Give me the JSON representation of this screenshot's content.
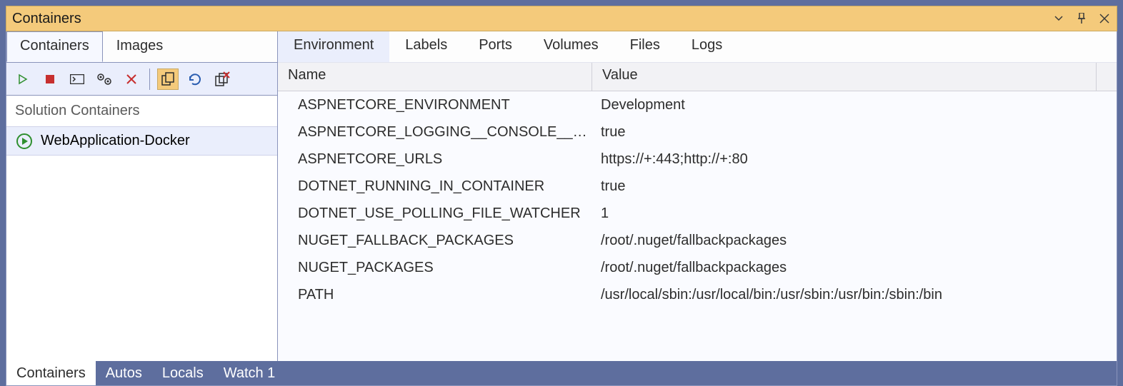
{
  "title": "Containers",
  "sidebar": {
    "tabs": [
      {
        "label": "Containers",
        "active": true
      },
      {
        "label": "Images",
        "active": false
      }
    ],
    "toolbar_icons": [
      "play",
      "stop",
      "terminal",
      "settings-gear",
      "delete",
      "copy",
      "refresh",
      "remove-copy"
    ],
    "section_label": "Solution Containers",
    "items": [
      {
        "icon": "running-icon",
        "label": "WebApplication-Docker"
      }
    ]
  },
  "right": {
    "tabs": [
      {
        "label": "Environment",
        "active": true
      },
      {
        "label": "Labels",
        "active": false
      },
      {
        "label": "Ports",
        "active": false
      },
      {
        "label": "Volumes",
        "active": false
      },
      {
        "label": "Files",
        "active": false
      },
      {
        "label": "Logs",
        "active": false
      }
    ],
    "columns": {
      "name": "Name",
      "value": "Value"
    },
    "rows": [
      {
        "name": "ASPNETCORE_ENVIRONMENT",
        "value": "Development"
      },
      {
        "name": "ASPNETCORE_LOGGING__CONSOLE__DISA...",
        "value": "true"
      },
      {
        "name": "ASPNETCORE_URLS",
        "value": "https://+:443;http://+:80"
      },
      {
        "name": "DOTNET_RUNNING_IN_CONTAINER",
        "value": "true"
      },
      {
        "name": "DOTNET_USE_POLLING_FILE_WATCHER",
        "value": "1"
      },
      {
        "name": "NUGET_FALLBACK_PACKAGES",
        "value": "/root/.nuget/fallbackpackages"
      },
      {
        "name": "NUGET_PACKAGES",
        "value": "/root/.nuget/fallbackpackages"
      },
      {
        "name": "PATH",
        "value": "/usr/local/sbin:/usr/local/bin:/usr/sbin:/usr/bin:/sbin:/bin"
      }
    ]
  },
  "bottom_tabs": [
    {
      "label": "Containers",
      "active": true
    },
    {
      "label": "Autos",
      "active": false
    },
    {
      "label": "Locals",
      "active": false
    },
    {
      "label": "Watch 1",
      "active": false
    }
  ]
}
